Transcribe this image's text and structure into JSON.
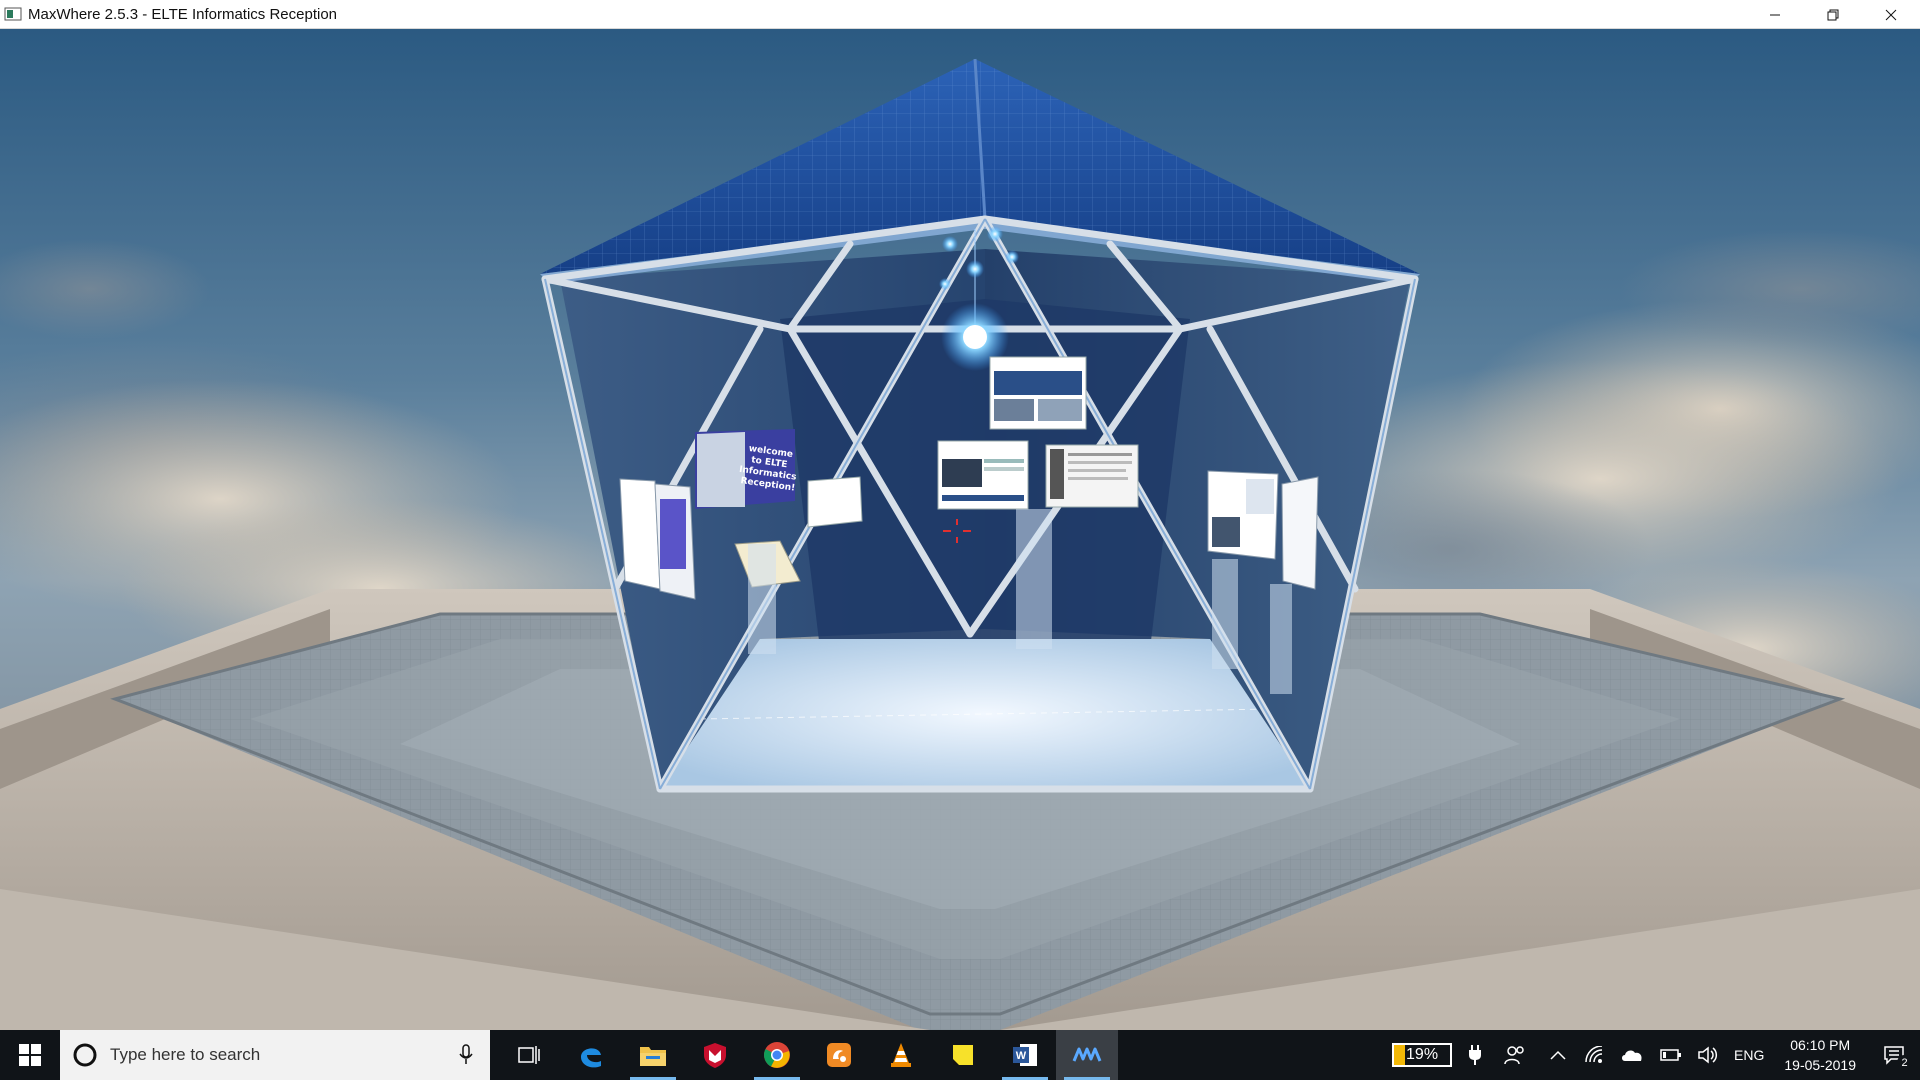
{
  "window": {
    "title": "MaxWhere 2.5.3 - ELTE Informatics Reception",
    "controls": [
      "minimize",
      "restore",
      "close"
    ]
  },
  "scene": {
    "welcome_panel_text": [
      "welcome",
      "to ELTE",
      "Informatics",
      "Reception!"
    ],
    "colors": {
      "sky_top": "#2f5f88",
      "sky_mid": "#6f8fa8",
      "roof_blue": "#1e4fa0",
      "glass": "#2a4a7a",
      "frame": "#cfd8e2",
      "floor_glow": "#cfe4f5",
      "platform_stone": "#b9b3ac",
      "platform_tile": "#8a959e"
    }
  },
  "taskbar": {
    "search_placeholder": "Type here to search",
    "apps": [
      {
        "name": "task-view",
        "icon": "task-view-icon"
      },
      {
        "name": "edge",
        "icon": "edge-icon"
      },
      {
        "name": "file-explorer",
        "icon": "folder-icon"
      },
      {
        "name": "mcafee",
        "icon": "mcafee-shield-icon"
      },
      {
        "name": "chrome",
        "icon": "chrome-icon"
      },
      {
        "name": "uc-browser",
        "icon": "uc-browser-icon"
      },
      {
        "name": "vlc",
        "icon": "vlc-cone-icon"
      },
      {
        "name": "sticky-notes",
        "icon": "sticky-note-icon"
      },
      {
        "name": "word",
        "icon": "word-icon"
      },
      {
        "name": "maxwhere",
        "icon": "maxwhere-icon"
      }
    ],
    "tray": {
      "battery_percent": "19%",
      "battery_level": 0.19,
      "language": "ENG",
      "time": "06:10 PM",
      "date": "19-05-2019",
      "notification_count": "2"
    }
  }
}
